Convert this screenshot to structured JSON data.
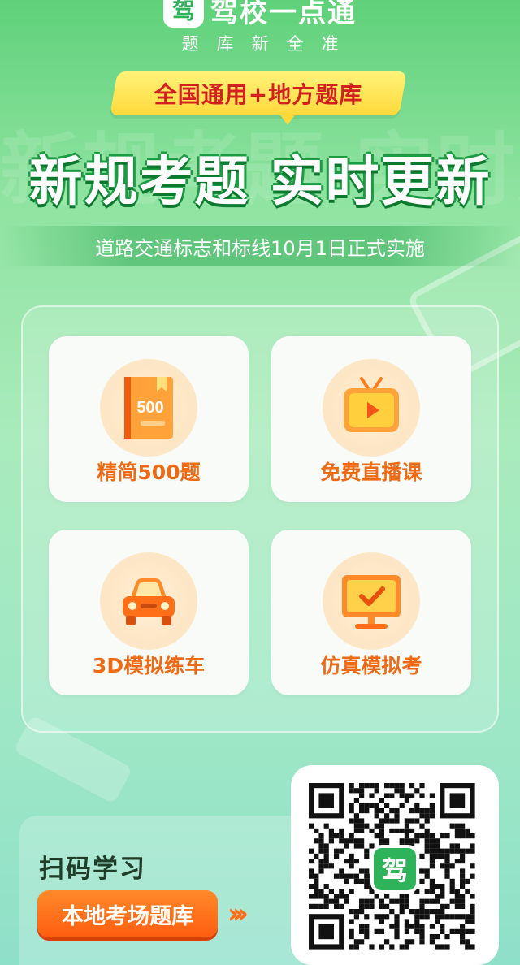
{
  "header": {
    "logo_glyph": "驾",
    "brand_name": "驾校一点通",
    "tagline": "题库新全准"
  },
  "banner": {
    "text": "全国通用+地方题库"
  },
  "headline": "新规考题 实时更新",
  "background_text": "新规考题 实时更新",
  "subtitle": "道路交通标志和标线10月1日正式实施",
  "features": [
    {
      "label": "精简500题",
      "icon": "book-icon",
      "icon_text": "500"
    },
    {
      "label": "免费直播课",
      "icon": "tv-play-icon"
    },
    {
      "label": "3D模拟练车",
      "icon": "car-icon"
    },
    {
      "label": "仿真模拟考",
      "icon": "monitor-check-icon"
    }
  ],
  "scan": {
    "title": "扫码学习",
    "button_label": "本地考场题库",
    "arrows": "›››"
  },
  "qr": {
    "logo_glyph": "驾"
  },
  "colors": {
    "brand_green": "#2fb35a",
    "accent_orange": "#ee6a14",
    "banner_yellow": "#ffd93a",
    "banner_red": "#d21f1f"
  }
}
